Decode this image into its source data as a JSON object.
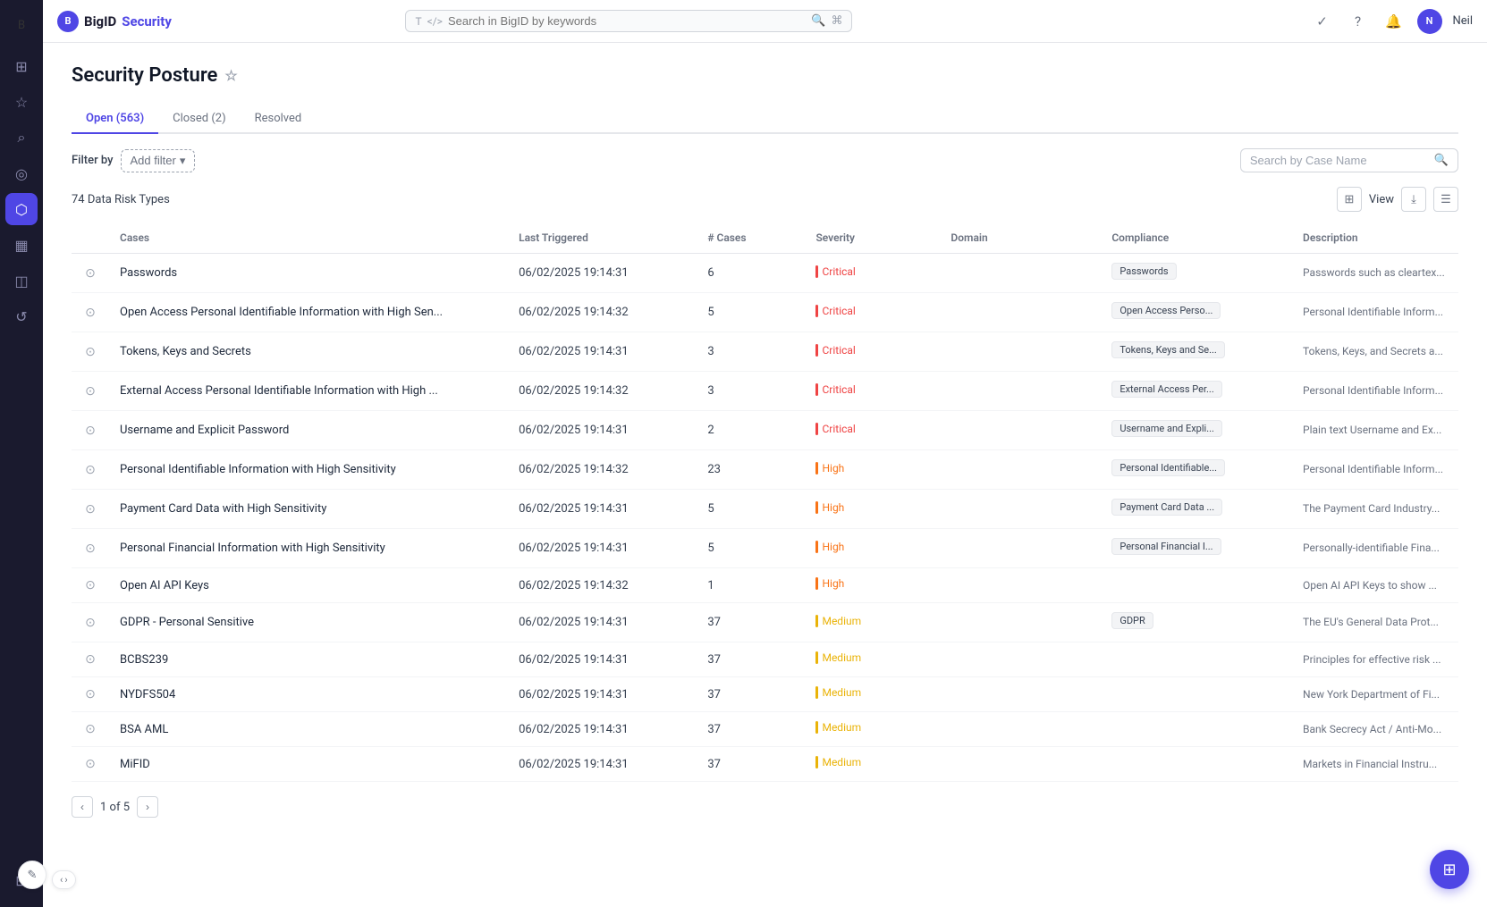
{
  "app": {
    "name": "BigID",
    "product": "Security",
    "user_initials": "N",
    "user_name": "Neil"
  },
  "topbar": {
    "search_placeholder": "Search in BigID by keywords"
  },
  "page": {
    "title": "Security Posture"
  },
  "tabs": [
    {
      "label": "Open (563)",
      "active": true
    },
    {
      "label": "Closed (2)",
      "active": false
    },
    {
      "label": "Resolved",
      "active": false
    }
  ],
  "filter": {
    "filter_by_label": "Filter by",
    "add_filter_label": "Add filter",
    "search_placeholder": "Search by Case Name"
  },
  "data_info": {
    "count_text": "74 Data Risk Types",
    "view_label": "View"
  },
  "table": {
    "headers": [
      "",
      "Cases",
      "Last Triggered",
      "# Cases",
      "Severity",
      "Domain",
      "Compliance",
      "Description"
    ],
    "rows": [
      {
        "name": "Passwords",
        "last_triggered": "06/02/2025 19:14:31",
        "cases": "6",
        "severity": "Critical",
        "severity_level": "critical",
        "domain": "",
        "compliance": "Passwords",
        "description": "Passwords such as cleartex..."
      },
      {
        "name": "Open Access Personal Identifiable Information with High Sen...",
        "last_triggered": "06/02/2025 19:14:32",
        "cases": "5",
        "severity": "Critical",
        "severity_level": "critical",
        "domain": "",
        "compliance": "Open Access Perso...",
        "description": "Personal Identifiable Inform..."
      },
      {
        "name": "Tokens, Keys and Secrets",
        "last_triggered": "06/02/2025 19:14:31",
        "cases": "3",
        "severity": "Critical",
        "severity_level": "critical",
        "domain": "",
        "compliance": "Tokens, Keys and Se...",
        "description": "Tokens, Keys, and Secrets a..."
      },
      {
        "name": "External Access Personal Identifiable Information with High ...",
        "last_triggered": "06/02/2025 19:14:32",
        "cases": "3",
        "severity": "Critical",
        "severity_level": "critical",
        "domain": "",
        "compliance": "External Access Per...",
        "description": "Personal Identifiable Inform..."
      },
      {
        "name": "Username and Explicit Password",
        "last_triggered": "06/02/2025 19:14:31",
        "cases": "2",
        "severity": "Critical",
        "severity_level": "critical",
        "domain": "",
        "compliance": "Username and Expli...",
        "description": "Plain text Username and Ex..."
      },
      {
        "name": "Personal Identifiable Information with High Sensitivity",
        "last_triggered": "06/02/2025 19:14:32",
        "cases": "23",
        "severity": "High",
        "severity_level": "high",
        "domain": "",
        "compliance": "Personal Identifiable...",
        "description": "Personal Identifiable Inform..."
      },
      {
        "name": "Payment Card Data with High Sensitivity",
        "last_triggered": "06/02/2025 19:14:31",
        "cases": "5",
        "severity": "High",
        "severity_level": "high",
        "domain": "",
        "compliance": "Payment Card Data ...",
        "description": "The Payment Card Industry..."
      },
      {
        "name": "Personal Financial Information with High Sensitivity",
        "last_triggered": "06/02/2025 19:14:31",
        "cases": "5",
        "severity": "High",
        "severity_level": "high",
        "domain": "",
        "compliance": "Personal Financial I...",
        "description": "Personally-identifiable Fina..."
      },
      {
        "name": "Open AI API Keys",
        "last_triggered": "06/02/2025 19:14:32",
        "cases": "1",
        "severity": "High",
        "severity_level": "high",
        "domain": "",
        "compliance": "",
        "description": "Open AI API Keys to show ..."
      },
      {
        "name": "GDPR - Personal Sensitive",
        "last_triggered": "06/02/2025 19:14:31",
        "cases": "37",
        "severity": "Medium",
        "severity_level": "medium",
        "domain": "",
        "compliance": "GDPR",
        "description": "The EU's General Data Prot..."
      },
      {
        "name": "BCBS239",
        "last_triggered": "06/02/2025 19:14:31",
        "cases": "37",
        "severity": "Medium",
        "severity_level": "medium",
        "domain": "",
        "compliance": "",
        "description": "Principles for effective risk ..."
      },
      {
        "name": "NYDFS504",
        "last_triggered": "06/02/2025 19:14:31",
        "cases": "37",
        "severity": "Medium",
        "severity_level": "medium",
        "domain": "",
        "compliance": "",
        "description": "New York Department of Fi..."
      },
      {
        "name": "BSA AML",
        "last_triggered": "06/02/2025 19:14:31",
        "cases": "37",
        "severity": "Medium",
        "severity_level": "medium",
        "domain": "",
        "compliance": "",
        "description": "Bank Secrecy Act / Anti-Mo..."
      },
      {
        "name": "MiFID",
        "last_triggered": "06/02/2025 19:14:31",
        "cases": "37",
        "severity": "Medium",
        "severity_level": "medium",
        "domain": "",
        "compliance": "",
        "description": "Markets in Financial Instru..."
      }
    ]
  },
  "pagination": {
    "current": "1",
    "total": "5"
  },
  "nav_icons": [
    {
      "name": "grid-icon",
      "glyph": "⊞"
    },
    {
      "name": "star-icon",
      "glyph": "☆"
    },
    {
      "name": "search-icon",
      "glyph": "⌕"
    },
    {
      "name": "compass-icon",
      "glyph": "◎"
    },
    {
      "name": "shield-icon",
      "glyph": "⬡"
    },
    {
      "name": "chart-icon",
      "glyph": "▦"
    },
    {
      "name": "database-icon",
      "glyph": "◫"
    },
    {
      "name": "refresh-icon",
      "glyph": "↺"
    },
    {
      "name": "grid2-icon",
      "glyph": "⊟"
    }
  ]
}
